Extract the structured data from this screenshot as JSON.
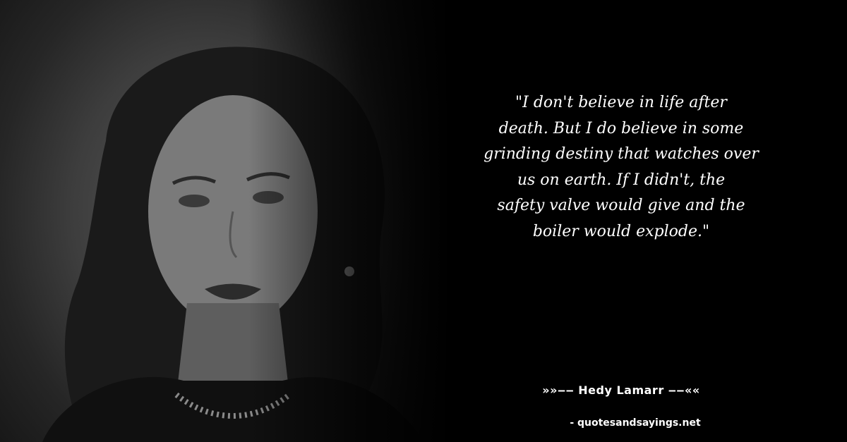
{
  "image": {
    "photo_alt": "Black-and-white portrait of Hedy Lamarr",
    "background_color": "#000000",
    "text_color": "#ffffff"
  },
  "quote": {
    "lines": [
      "\"I don't believe in life after",
      "death. But I do believe in some",
      "grinding destiny that watches over",
      "us on earth. If I didn't, the",
      "safety valve would give and the",
      "boiler would explode.\""
    ]
  },
  "attribution": "»»‒‒ Hedy Lamarr ‒‒««",
  "source": "- quotesandsayings.net"
}
